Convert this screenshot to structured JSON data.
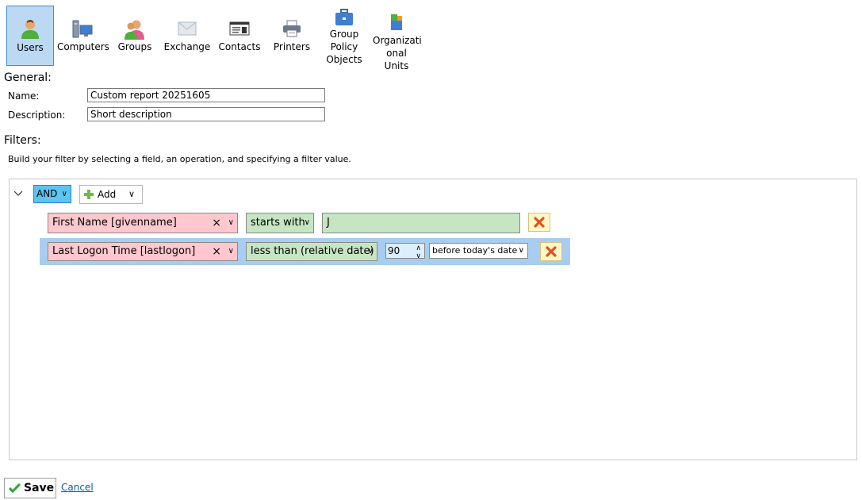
{
  "toolbar": {
    "items": [
      {
        "label": "Users",
        "icon": "user-icon"
      },
      {
        "label": "Computers",
        "icon": "computer-icon"
      },
      {
        "label": "Groups",
        "icon": "group-icon"
      },
      {
        "label": "Exchange",
        "icon": "mail-icon"
      },
      {
        "label": "Contacts",
        "icon": "contact-card-icon"
      },
      {
        "label": "Printers",
        "icon": "printer-icon"
      },
      {
        "label_lines": [
          "Group",
          "Policy",
          "Objects"
        ],
        "icon": "briefcase-icon"
      },
      {
        "label_lines": [
          "Organizati",
          "onal Units"
        ],
        "icon": "org-unit-icon"
      }
    ],
    "selected": "Users"
  },
  "general": {
    "title": "General:",
    "name_label": "Name:",
    "name_value": "Custom report 20251605",
    "description_label": "Description:",
    "description_value": "Short description"
  },
  "filters": {
    "title": "Filters:",
    "hint": "Build your filter by selecting a field, an operation, and specifying a filter value.",
    "logic_operator": "AND",
    "add_label": "Add",
    "rows": [
      {
        "field": "First Name [givenname]",
        "operation": "starts with",
        "value": "J"
      },
      {
        "field": "Last Logon Time [lastlogon]",
        "operation": "less than (relative date)",
        "number": "90",
        "unit": "before today's date"
      }
    ]
  },
  "footer": {
    "save_label": "Save",
    "cancel_label": "Cancel"
  },
  "colors": {
    "selected_bg": "#bcd9f3",
    "field_bg": "#ffc7ce",
    "op_bg": "#c6e6c3",
    "row_highlight": "#a8cdf0",
    "delete_bg": "#fff7c7"
  }
}
